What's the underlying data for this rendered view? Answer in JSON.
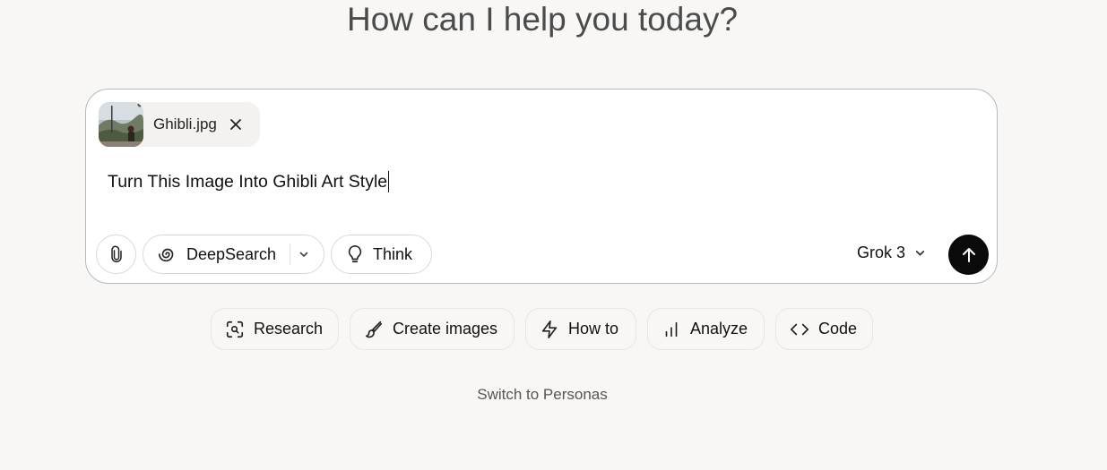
{
  "headline": "How can I help you today?",
  "attachment": {
    "filename": "Ghibli.jpg",
    "thumbnail_icon": "image-thumbnail",
    "remove_icon": "close-icon"
  },
  "prompt": {
    "value": "Turn This Image Into Ghibli Art Style"
  },
  "toolbar": {
    "attach_icon": "paperclip-icon",
    "deepsearch_label": "DeepSearch",
    "deepsearch_icon": "spiral-icon",
    "think_label": "Think",
    "think_icon": "lightbulb-icon",
    "model_label": "Grok 3",
    "send_icon": "arrow-up-icon"
  },
  "suggestions": [
    {
      "label": "Research",
      "icon": "scan-search-icon"
    },
    {
      "label": "Create images",
      "icon": "paintbrush-icon"
    },
    {
      "label": "How to",
      "icon": "lightning-icon"
    },
    {
      "label": "Analyze",
      "icon": "bar-chart-icon"
    },
    {
      "label": "Code",
      "icon": "code-icon"
    }
  ],
  "switch_link": "Switch to Personas",
  "colors": {
    "background": "#f8f7f5",
    "send_button": "#0a0a0a",
    "border": "#b9b9b9"
  }
}
